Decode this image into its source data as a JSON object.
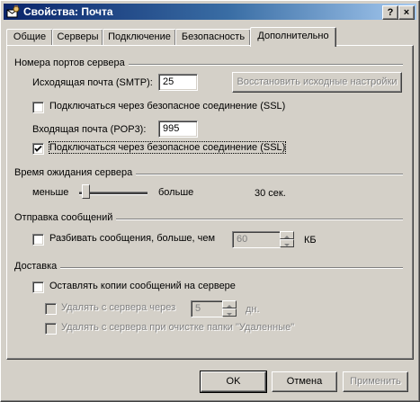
{
  "window": {
    "title": "Свойства: Почта",
    "help": "?",
    "close": "×"
  },
  "tabs": [
    {
      "label": "Общие",
      "active": false
    },
    {
      "label": "Серверы",
      "active": false
    },
    {
      "label": "Подключение",
      "active": false
    },
    {
      "label": "Безопасность",
      "active": false
    },
    {
      "label": "Дополнительно",
      "active": true
    }
  ],
  "ports": {
    "group_title": "Номера портов сервера",
    "smtp_label": "Исходящая почта (SMTP):",
    "smtp_value": "25",
    "restore_button": "Восстановить исходные настройки",
    "smtp_ssl_label": "Подключаться через безопасное соединение (SSL)",
    "smtp_ssl_checked": false,
    "pop3_label": "Входящая почта (POP3):",
    "pop3_value": "995",
    "pop3_ssl_label": "Подключаться через безопасное соединение (SSL)",
    "pop3_ssl_checked": true
  },
  "timeout": {
    "group_title": "Время ожидания сервера",
    "less_label": "меньше",
    "more_label": "больше",
    "value_text": "30 сек.",
    "slider_level": 0.05
  },
  "sending": {
    "group_title": "Отправка сообщений",
    "split_label": "Разбивать сообщения, больше, чем",
    "split_checked": false,
    "split_value": "60",
    "unit": "КБ"
  },
  "delivery": {
    "group_title": "Доставка",
    "keep_copy_label": "Оставлять копии сообщений на сервере",
    "keep_copy_checked": false,
    "delete_after_label": "Удалять с сервера через",
    "delete_after_value": "5",
    "days_label": "дн.",
    "delete_on_empty_label": "Удалять с сервера при очистке папки \"Удаленные\""
  },
  "footer": {
    "ok": "OK",
    "cancel": "Отмена",
    "apply": "Применить"
  },
  "colors": {
    "face": "#d4d0c8",
    "title_start": "#0a246a",
    "title_end": "#a6caf0"
  }
}
